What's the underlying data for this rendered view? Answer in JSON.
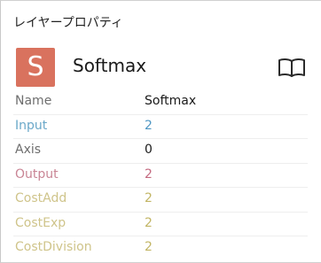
{
  "panel": {
    "title": "レイヤープロパティ"
  },
  "layer": {
    "badge_letter": "S",
    "badge_color": "#d9725e",
    "name": "Softmax",
    "doc_icon": "book-open-icon"
  },
  "properties": [
    {
      "key": "Name",
      "value": "Softmax",
      "key_color": "#6e6e6e",
      "value_color": "#1a1a1a"
    },
    {
      "key": "Input",
      "value": "2",
      "key_color": "#6ba8c9",
      "value_color": "#4f97c4"
    },
    {
      "key": "Axis",
      "value": "0",
      "key_color": "#6e6e6e",
      "value_color": "#1a1a1a"
    },
    {
      "key": "Output",
      "value": "2",
      "key_color": "#c98595",
      "value_color": "#c46a80"
    },
    {
      "key": "CostAdd",
      "value": "2",
      "key_color": "#cfc48a",
      "value_color": "#c2b564"
    },
    {
      "key": "CostExp",
      "value": "2",
      "key_color": "#cfc48a",
      "value_color": "#c2b564"
    },
    {
      "key": "CostDivision",
      "value": "2",
      "key_color": "#cfc48a",
      "value_color": "#c2b564"
    }
  ]
}
